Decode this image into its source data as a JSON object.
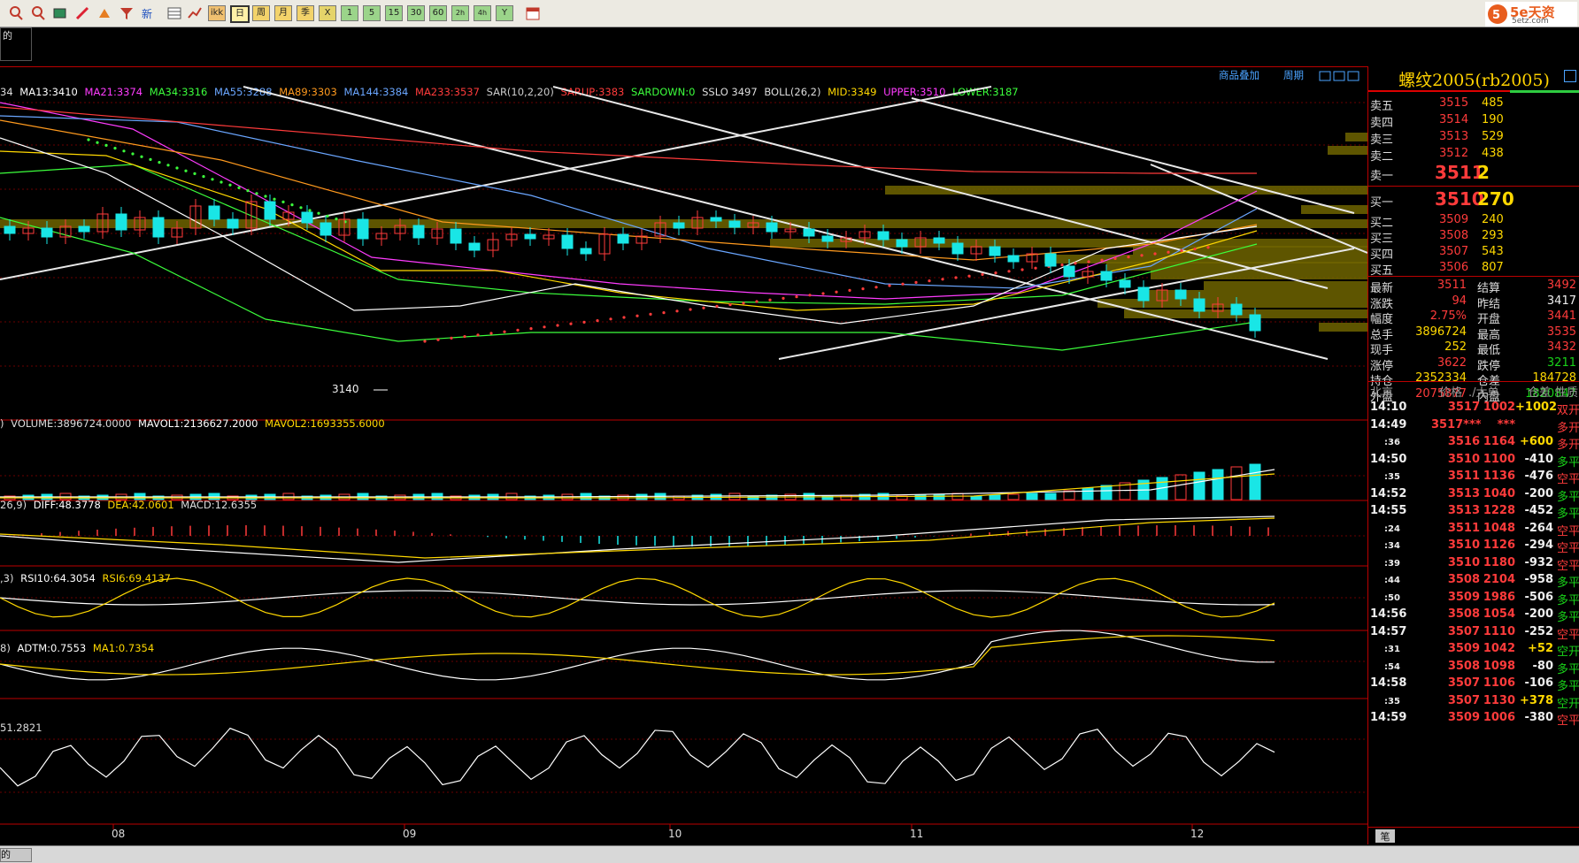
{
  "toolbar": {
    "buttons": [
      "ikk",
      "日",
      "周",
      "月",
      "季",
      "X",
      "1",
      "5",
      "15",
      "30",
      "60",
      "2h",
      "4h",
      "Y"
    ],
    "colors": {
      "bg": "#eceae2"
    }
  },
  "logo": {
    "text": "5e天资",
    "sub": "5etz.com"
  },
  "left_tab": {
    "line1": "的"
  },
  "bottom_tab": {
    "line1": "的"
  },
  "chart_header": {
    "right1": "商品叠加",
    "right2": "周期"
  },
  "main_legend": [
    {
      "text": "MA13:3410",
      "color": "#ffffff"
    },
    {
      "text": "MA21:3374",
      "color": "#ff3cff"
    },
    {
      "text": "MA34:3316",
      "color": "#3cff3c"
    },
    {
      "text": "MA55:3288",
      "color": "#6aa6ff"
    },
    {
      "text": "MA89:3303",
      "color": "#ff9a1e"
    },
    {
      "text": "MA144:3384",
      "color": "#6aa6ff"
    },
    {
      "text": "MA233:3537",
      "color": "#ff3b3b"
    },
    {
      "text": "SAR(10,2,20)",
      "color": "#cccccc"
    },
    {
      "text": "SARUP:3383",
      "color": "#ff3b3b"
    },
    {
      "text": "SARDOWN:0",
      "color": "#3cff3c"
    },
    {
      "text": "SSLO 3497",
      "color": "#dddddd"
    },
    {
      "text": "BOLL(26,2)",
      "color": "#dddddd"
    },
    {
      "text": "MID:3349",
      "color": "#ffd800"
    },
    {
      "text": "UPPER:3510",
      "color": "#ff3cff"
    },
    {
      "text": "LOWER:3187",
      "color": "#3cff3c"
    }
  ],
  "main_legend_prefix": "34",
  "low_label": "3140",
  "vol_legend": [
    {
      "text": "VOLUME:3896724.0000",
      "color": "#dddddd"
    },
    {
      "text": "MAVOL1:2136627.2000",
      "color": "#ffffff"
    },
    {
      "text": "MAVOL2:1693355.6000",
      "color": "#ffd800"
    }
  ],
  "macd_legend": [
    {
      "text": "26,9)",
      "color": "#dddddd"
    },
    {
      "text": "DIFF:48.3778",
      "color": "#ffffff"
    },
    {
      "text": "DEA:42.0601",
      "color": "#ffd800"
    },
    {
      "text": "MACD:12.6355",
      "color": "#dddddd"
    }
  ],
  "rsi_legend": [
    {
      "text": ",3)",
      "color": "#dddddd"
    },
    {
      "text": "RSI10:64.3054",
      "color": "#ffffff"
    },
    {
      "text": "RSI6:69.4137",
      "color": "#ffd800"
    }
  ],
  "adtm_legend": [
    {
      "text": "8)",
      "color": "#dddddd"
    },
    {
      "text": "ADTM:0.7553",
      "color": "#ffffff"
    },
    {
      "text": "MA1:0.7354",
      "color": "#ffd800"
    }
  ],
  "last_legend": [
    {
      "text": "51.2821",
      "color": "#dddddd"
    }
  ],
  "x_axis": [
    "08",
    "09",
    "10",
    "11",
    "12"
  ],
  "quote": {
    "title": "螺纹2005(rb2005)",
    "asks": [
      {
        "label": "卖五",
        "price": "3515",
        "vol": "485"
      },
      {
        "label": "卖四",
        "price": "3514",
        "vol": "190"
      },
      {
        "label": "卖三",
        "price": "3513",
        "vol": "529"
      },
      {
        "label": "卖二",
        "price": "3512",
        "vol": "438"
      },
      {
        "label": "卖一",
        "price": "3511",
        "vol": "2"
      }
    ],
    "bids": [
      {
        "label": "买一",
        "price": "3510",
        "vol": "270"
      },
      {
        "label": "买二",
        "price": "3509",
        "vol": "240"
      },
      {
        "label": "买三",
        "price": "3508",
        "vol": "293"
      },
      {
        "label": "买四",
        "price": "3507",
        "vol": "543"
      },
      {
        "label": "买五",
        "price": "3506",
        "vol": "807"
      }
    ],
    "stats": [
      {
        "l1": "最新",
        "v1": "3511",
        "c1": "red",
        "l2": "结算",
        "v2": "3492",
        "c2": "red"
      },
      {
        "l1": "涨跌",
        "v1": "94",
        "c1": "red",
        "l2": "昨结",
        "v2": "3417",
        "c2": "wht"
      },
      {
        "l1": "幅度",
        "v1": "2.75%",
        "c1": "red",
        "l2": "开盘",
        "v2": "3441",
        "c2": "red"
      },
      {
        "l1": "总手",
        "v1": "3896724",
        "c1": "yel",
        "l2": "最高",
        "v2": "3535",
        "c2": "red"
      },
      {
        "l1": "现手",
        "v1": "252",
        "c1": "yel",
        "l2": "最低",
        "v2": "3432",
        "c2": "red"
      },
      {
        "l1": "涨停",
        "v1": "3622",
        "c1": "red",
        "l2": "跌停",
        "v2": "3211",
        "c2": "grn"
      },
      {
        "l1": "持仓",
        "v1": "2352334",
        "c1": "yel",
        "l2": "仓差",
        "v2": "184728",
        "c2": "yel"
      },
      {
        "l1": "外盘",
        "v1": "2075877",
        "c1": "red",
        "l2": "内盘",
        "v2": "1820847",
        "c2": "grn"
      }
    ],
    "ticks_header": [
      "北京",
      "价格",
      "./大单",
      "仓差",
      "性质"
    ],
    "ticks": [
      {
        "t": "14:10",
        "p": "3517",
        "v": "1002",
        "d": "+1002",
        "n": "双开",
        "pc": "red",
        "dc": "yel",
        "nc": "red"
      },
      {
        "t": "14:49",
        "p": "3517***",
        "v": "***",
        "d": "",
        "n": "多开",
        "pc": "red",
        "dc": "yel",
        "nc": "red"
      },
      {
        "t": ":36",
        "p": "3516",
        "v": "1164",
        "d": "+600",
        "n": "多开",
        "pc": "red",
        "dc": "yel",
        "nc": "red"
      },
      {
        "t": "14:50",
        "p": "3510",
        "v": "1100",
        "d": "-410",
        "n": "多平",
        "pc": "red",
        "dc": "wht",
        "nc": "grn"
      },
      {
        "t": ":35",
        "p": "3511",
        "v": "1136",
        "d": "-476",
        "n": "空平",
        "pc": "red",
        "dc": "wht",
        "nc": "red"
      },
      {
        "t": "14:52",
        "p": "3513",
        "v": "1040",
        "d": "-200",
        "n": "多平",
        "pc": "red",
        "dc": "wht",
        "nc": "grn"
      },
      {
        "t": "14:55",
        "p": "3513",
        "v": "1228",
        "d": "-452",
        "n": "多平",
        "pc": "red",
        "dc": "wht",
        "nc": "grn"
      },
      {
        "t": ":24",
        "p": "3511",
        "v": "1048",
        "d": "-264",
        "n": "空平",
        "pc": "red",
        "dc": "wht",
        "nc": "red"
      },
      {
        "t": ":34",
        "p": "3510",
        "v": "1126",
        "d": "-294",
        "n": "空平",
        "pc": "red",
        "dc": "wht",
        "nc": "red"
      },
      {
        "t": ":39",
        "p": "3510",
        "v": "1180",
        "d": "-932",
        "n": "空平",
        "pc": "red",
        "dc": "wht",
        "nc": "red"
      },
      {
        "t": ":44",
        "p": "3508",
        "v": "2104",
        "d": "-958",
        "n": "多平",
        "pc": "red",
        "dc": "wht",
        "nc": "grn"
      },
      {
        "t": ":50",
        "p": "3509",
        "v": "1986",
        "d": "-506",
        "n": "多平",
        "pc": "red",
        "dc": "wht",
        "nc": "grn"
      },
      {
        "t": "14:56",
        "p": "3508",
        "v": "1054",
        "d": "-200",
        "n": "多平",
        "pc": "red",
        "dc": "wht",
        "nc": "grn"
      },
      {
        "t": "14:57",
        "p": "3507",
        "v": "1110",
        "d": "-252",
        "n": "空平",
        "pc": "red",
        "dc": "wht",
        "nc": "red"
      },
      {
        "t": ":31",
        "p": "3509",
        "v": "1042",
        "d": "+52",
        "n": "空开",
        "pc": "red",
        "dc": "yel",
        "nc": "grn"
      },
      {
        "t": ":54",
        "p": "3508",
        "v": "1098",
        "d": "-80",
        "n": "多平",
        "pc": "red",
        "dc": "wht",
        "nc": "grn"
      },
      {
        "t": "14:58",
        "p": "3507",
        "v": "1106",
        "d": "-106",
        "n": "多平",
        "pc": "red",
        "dc": "wht",
        "nc": "grn"
      },
      {
        "t": ":35",
        "p": "3507",
        "v": "1130",
        "d": "+378",
        "n": "空开",
        "pc": "red",
        "dc": "yel",
        "nc": "grn"
      },
      {
        "t": "14:59",
        "p": "3509",
        "v": "1006",
        "d": "-380",
        "n": "空平",
        "pc": "red",
        "dc": "wht",
        "nc": "red"
      }
    ],
    "footer_tab": "笔"
  }
}
